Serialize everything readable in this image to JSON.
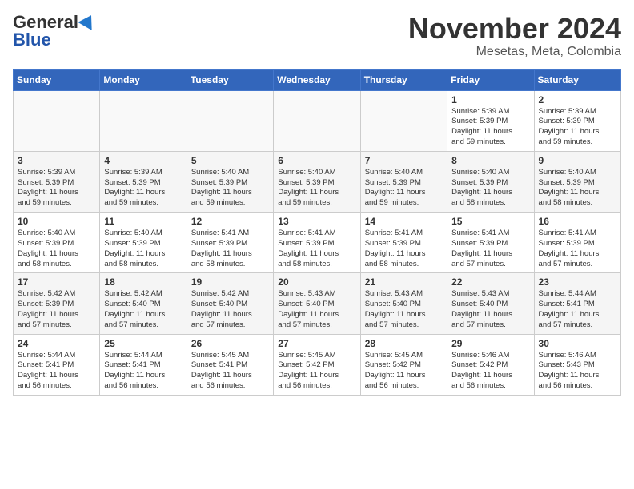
{
  "header": {
    "logo_general": "General",
    "logo_blue": "Blue",
    "month_year": "November 2024",
    "location": "Mesetas, Meta, Colombia"
  },
  "weekdays": [
    "Sunday",
    "Monday",
    "Tuesday",
    "Wednesday",
    "Thursday",
    "Friday",
    "Saturday"
  ],
  "weeks": [
    [
      {
        "day": "",
        "info": ""
      },
      {
        "day": "",
        "info": ""
      },
      {
        "day": "",
        "info": ""
      },
      {
        "day": "",
        "info": ""
      },
      {
        "day": "",
        "info": ""
      },
      {
        "day": "1",
        "info": "Sunrise: 5:39 AM\nSunset: 5:39 PM\nDaylight: 11 hours\nand 59 minutes."
      },
      {
        "day": "2",
        "info": "Sunrise: 5:39 AM\nSunset: 5:39 PM\nDaylight: 11 hours\nand 59 minutes."
      }
    ],
    [
      {
        "day": "3",
        "info": "Sunrise: 5:39 AM\nSunset: 5:39 PM\nDaylight: 11 hours\nand 59 minutes."
      },
      {
        "day": "4",
        "info": "Sunrise: 5:39 AM\nSunset: 5:39 PM\nDaylight: 11 hours\nand 59 minutes."
      },
      {
        "day": "5",
        "info": "Sunrise: 5:40 AM\nSunset: 5:39 PM\nDaylight: 11 hours\nand 59 minutes."
      },
      {
        "day": "6",
        "info": "Sunrise: 5:40 AM\nSunset: 5:39 PM\nDaylight: 11 hours\nand 59 minutes."
      },
      {
        "day": "7",
        "info": "Sunrise: 5:40 AM\nSunset: 5:39 PM\nDaylight: 11 hours\nand 59 minutes."
      },
      {
        "day": "8",
        "info": "Sunrise: 5:40 AM\nSunset: 5:39 PM\nDaylight: 11 hours\nand 58 minutes."
      },
      {
        "day": "9",
        "info": "Sunrise: 5:40 AM\nSunset: 5:39 PM\nDaylight: 11 hours\nand 58 minutes."
      }
    ],
    [
      {
        "day": "10",
        "info": "Sunrise: 5:40 AM\nSunset: 5:39 PM\nDaylight: 11 hours\nand 58 minutes."
      },
      {
        "day": "11",
        "info": "Sunrise: 5:40 AM\nSunset: 5:39 PM\nDaylight: 11 hours\nand 58 minutes."
      },
      {
        "day": "12",
        "info": "Sunrise: 5:41 AM\nSunset: 5:39 PM\nDaylight: 11 hours\nand 58 minutes."
      },
      {
        "day": "13",
        "info": "Sunrise: 5:41 AM\nSunset: 5:39 PM\nDaylight: 11 hours\nand 58 minutes."
      },
      {
        "day": "14",
        "info": "Sunrise: 5:41 AM\nSunset: 5:39 PM\nDaylight: 11 hours\nand 58 minutes."
      },
      {
        "day": "15",
        "info": "Sunrise: 5:41 AM\nSunset: 5:39 PM\nDaylight: 11 hours\nand 57 minutes."
      },
      {
        "day": "16",
        "info": "Sunrise: 5:41 AM\nSunset: 5:39 PM\nDaylight: 11 hours\nand 57 minutes."
      }
    ],
    [
      {
        "day": "17",
        "info": "Sunrise: 5:42 AM\nSunset: 5:39 PM\nDaylight: 11 hours\nand 57 minutes."
      },
      {
        "day": "18",
        "info": "Sunrise: 5:42 AM\nSunset: 5:40 PM\nDaylight: 11 hours\nand 57 minutes."
      },
      {
        "day": "19",
        "info": "Sunrise: 5:42 AM\nSunset: 5:40 PM\nDaylight: 11 hours\nand 57 minutes."
      },
      {
        "day": "20",
        "info": "Sunrise: 5:43 AM\nSunset: 5:40 PM\nDaylight: 11 hours\nand 57 minutes."
      },
      {
        "day": "21",
        "info": "Sunrise: 5:43 AM\nSunset: 5:40 PM\nDaylight: 11 hours\nand 57 minutes."
      },
      {
        "day": "22",
        "info": "Sunrise: 5:43 AM\nSunset: 5:40 PM\nDaylight: 11 hours\nand 57 minutes."
      },
      {
        "day": "23",
        "info": "Sunrise: 5:44 AM\nSunset: 5:41 PM\nDaylight: 11 hours\nand 57 minutes."
      }
    ],
    [
      {
        "day": "24",
        "info": "Sunrise: 5:44 AM\nSunset: 5:41 PM\nDaylight: 11 hours\nand 56 minutes."
      },
      {
        "day": "25",
        "info": "Sunrise: 5:44 AM\nSunset: 5:41 PM\nDaylight: 11 hours\nand 56 minutes."
      },
      {
        "day": "26",
        "info": "Sunrise: 5:45 AM\nSunset: 5:41 PM\nDaylight: 11 hours\nand 56 minutes."
      },
      {
        "day": "27",
        "info": "Sunrise: 5:45 AM\nSunset: 5:42 PM\nDaylight: 11 hours\nand 56 minutes."
      },
      {
        "day": "28",
        "info": "Sunrise: 5:45 AM\nSunset: 5:42 PM\nDaylight: 11 hours\nand 56 minutes."
      },
      {
        "day": "29",
        "info": "Sunrise: 5:46 AM\nSunset: 5:42 PM\nDaylight: 11 hours\nand 56 minutes."
      },
      {
        "day": "30",
        "info": "Sunrise: 5:46 AM\nSunset: 5:43 PM\nDaylight: 11 hours\nand 56 minutes."
      }
    ]
  ]
}
